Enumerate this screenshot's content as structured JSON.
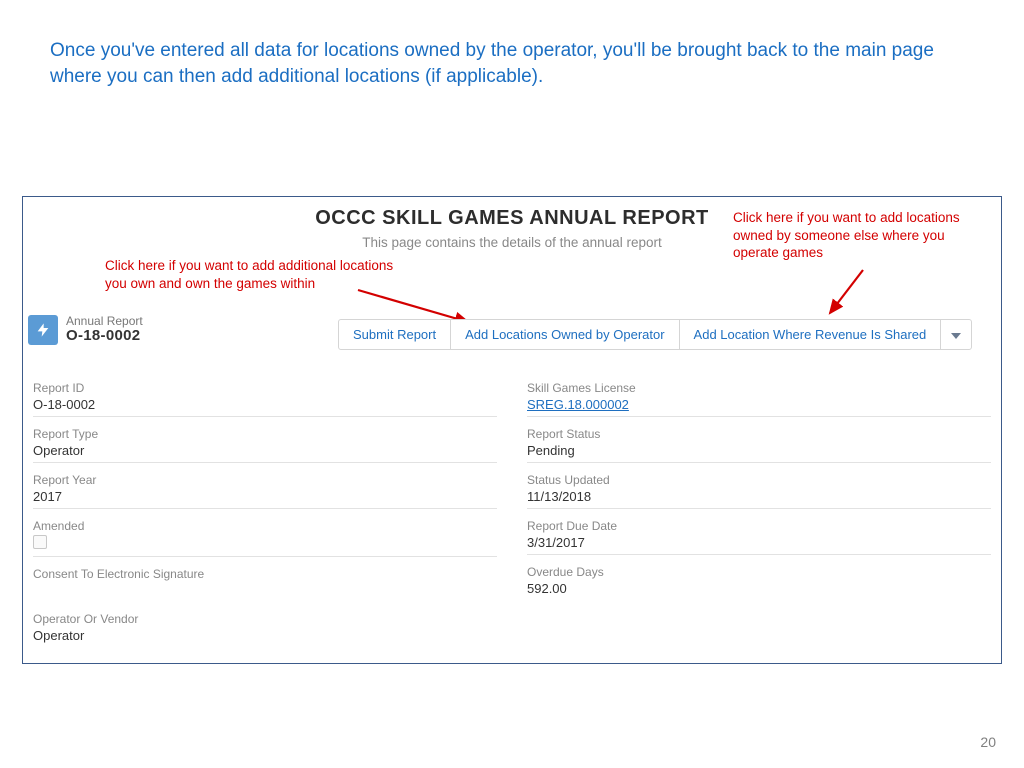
{
  "slide": {
    "caption": "Once you've entered all data for locations owned by the operator, you'll be brought back to the main page where you can then add additional locations (if applicable).",
    "pageNumber": "20"
  },
  "annotations": {
    "left": "Click here if you want to add additional locations you own and own the games within",
    "right": "Click here if you want to add locations owned by someone else where you operate games"
  },
  "header": {
    "title": "OCCC SKILL GAMES ANNUAL REPORT",
    "subtitle": "This page contains the details of the annual report"
  },
  "reportBadge": {
    "label": "Annual Report",
    "id": "O-18-0002"
  },
  "buttons": {
    "submit": "Submit Report",
    "addOwned": "Add Locations Owned by Operator",
    "addShared": "Add Location Where Revenue Is Shared"
  },
  "fieldsLeft": {
    "reportId": {
      "label": "Report ID",
      "value": "O-18-0002"
    },
    "reportType": {
      "label": "Report Type",
      "value": "Operator"
    },
    "reportYear": {
      "label": "Report Year",
      "value": "2017"
    },
    "amended": {
      "label": "Amended"
    },
    "consent": {
      "label": "Consent To Electronic Signature"
    },
    "opVendor": {
      "label": "Operator Or Vendor",
      "value": "Operator"
    }
  },
  "fieldsRight": {
    "license": {
      "label": "Skill Games License",
      "value": "SREG.18.000002"
    },
    "status": {
      "label": "Report Status",
      "value": "Pending"
    },
    "statusUpdated": {
      "label": "Status Updated",
      "value": "11/13/2018"
    },
    "dueDate": {
      "label": "Report Due Date",
      "value": "3/31/2017"
    },
    "overdue": {
      "label": "Overdue Days",
      "value": "592.00"
    }
  }
}
